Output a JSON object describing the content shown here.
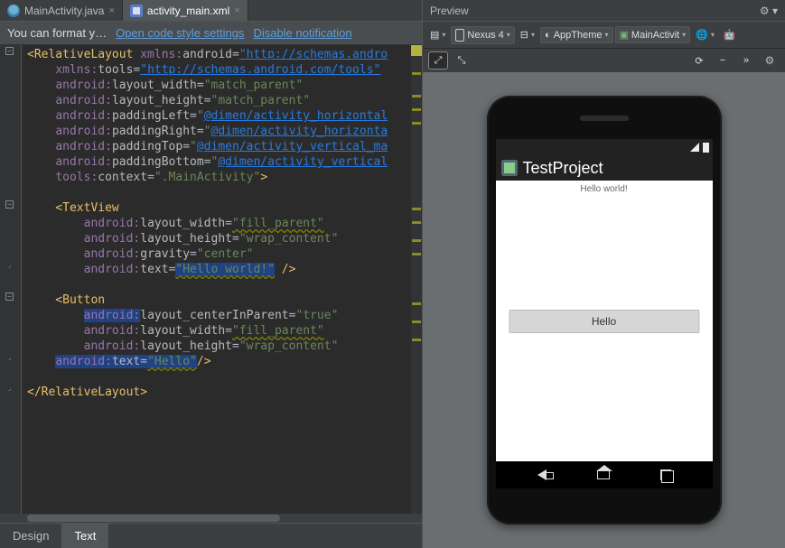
{
  "tabs": {
    "java": "MainActivity.java",
    "xml": "activity_main.xml"
  },
  "notice": {
    "msg": "You can format y…",
    "link1": "Open code style settings",
    "link2": "Disable notification"
  },
  "code": {
    "l1a": "<",
    "l1b": "RelativeLayout",
    "l1c": " ",
    "l1d": "xmlns:",
    "l1e": "android",
    "l1f": "=",
    "l1g": "\"http://schemas.andro",
    "l2a": "    ",
    "l2b": "xmlns:",
    "l2c": "tools",
    "l2d": "=",
    "l2e": "\"http://schemas.android.com/tools\"",
    "l3a": "    ",
    "l3b": "android:",
    "l3c": "layout_width",
    "l3d": "=",
    "l3e": "\"match_parent\"",
    "l4a": "    ",
    "l4b": "android:",
    "l4c": "layout_height",
    "l4d": "=",
    "l4e": "\"match_parent\"",
    "l5a": "    ",
    "l5b": "android:",
    "l5c": "paddingLeft",
    "l5d": "=",
    "l5e": "\"",
    "l5f": "@dimen/activity_horizontal",
    "l6a": "    ",
    "l6b": "android:",
    "l6c": "paddingRight",
    "l6d": "=",
    "l6e": "\"",
    "l6f": "@dimen/activity_horizonta",
    "l7a": "    ",
    "l7b": "android:",
    "l7c": "paddingTop",
    "l7d": "=",
    "l7e": "\"",
    "l7f": "@dimen/activity_vertical_ma",
    "l8a": "    ",
    "l8b": "android:",
    "l8c": "paddingBottom",
    "l8d": "=",
    "l8e": "\"",
    "l8f": "@dimen/activity_vertical",
    "l9a": "    ",
    "l9b": "tools:",
    "l9c": "context",
    "l9d": "=",
    "l9e": "\".MainActivity\"",
    "l9f": ">",
    "l11a": "    <",
    "l11b": "TextView",
    "l12a": "        ",
    "l12b": "android:",
    "l12c": "layout_width",
    "l12d": "=",
    "l12e": "\"fill_parent\"",
    "l13a": "        ",
    "l13b": "android:",
    "l13c": "layout_height",
    "l13d": "=",
    "l13e": "\"wrap_content\"",
    "l14a": "        ",
    "l14b": "android:",
    "l14c": "gravity",
    "l14d": "=",
    "l14e": "\"center\"",
    "l15a": "        ",
    "l15b": "android:",
    "l15c": "text",
    "l15d": "=",
    "l15e": "\"Hello world!\"",
    "l15f": " />",
    "l17a": "    <",
    "l17b": "Button",
    "l18a": "        ",
    "l18b": "android:",
    "l18c": "layout_centerInParent",
    "l18d": "=",
    "l18e": "\"true\"",
    "l19a": "        ",
    "l19b": "android:",
    "l19c": "layout_width",
    "l19d": "=",
    "l19e": "\"fill_parent\"",
    "l20a": "        ",
    "l20b": "android:",
    "l20c": "layout_height",
    "l20d": "=",
    "l20e": "\"wrap_content\"",
    "l21a": "    ",
    "l21b": "android:",
    "l21c": "text",
    "l21d": "=",
    "l21e": "\"Hello\"",
    "l21f": "/>",
    "l23a": "</",
    "l23b": "RelativeLayout",
    "l23c": ">"
  },
  "bottom": {
    "design": "Design",
    "text": "Text"
  },
  "preview": {
    "title": "Preview",
    "device": "Nexus 4",
    "theme": "AppTheme",
    "activity": "MainActivit",
    "toolbar_v": ""
  },
  "app": {
    "title": "TestProject",
    "hello": "Hello world!",
    "button": "Hello"
  }
}
